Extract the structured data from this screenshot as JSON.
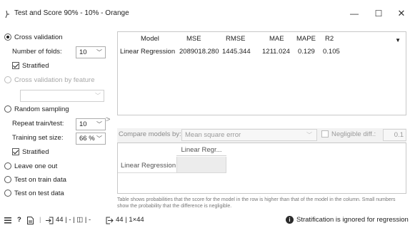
{
  "window": {
    "title": "Test and Score 90% - 10% - Orange",
    "min_glyph": "—",
    "max_glyph": "☐",
    "close_glyph": "✕"
  },
  "sampling": {
    "cross_validation": {
      "label": "Cross validation",
      "checked": true
    },
    "number_of_folds": {
      "label": "Number of folds:",
      "value": "10"
    },
    "stratified_cv": {
      "label": "Stratified",
      "checked": true
    },
    "cv_by_feature": {
      "label": "Cross validation by feature",
      "enabled": false
    },
    "feature_combo_value": "",
    "random_sampling": {
      "label": "Random sampling",
      "checked": false
    },
    "repeat_train_test": {
      "label": "Repeat train/test:",
      "value": "10"
    },
    "training_set_size": {
      "label": "Training set size:",
      "value": "66 %"
    },
    "stratified_rs": {
      "label": "Stratified",
      "checked": true
    },
    "leave_one_out": {
      "label": "Leave one out",
      "checked": false
    },
    "test_on_train": {
      "label": "Test on train data",
      "checked": false
    },
    "test_on_test": {
      "label": "Test on test data",
      "checked": false
    }
  },
  "splitter_glyph": ">",
  "results": {
    "columns": [
      "Model",
      "MSE",
      "RMSE",
      "MAE",
      "MAPE",
      "R2"
    ],
    "rows": [
      [
        "Linear Regression",
        "2089018.280",
        "1445.344",
        "1211.024",
        "0.129",
        "0.105"
      ]
    ],
    "sort_glyph": "▼"
  },
  "compare": {
    "label": "Compare models by:",
    "value": "Mean square error",
    "negligible_label": "Negligible diff.:",
    "negligible_value": "0.1"
  },
  "comparison_table": {
    "column_header": "Linear Regr...",
    "row_header": "Linear Regression"
  },
  "footnote": "Table shows probabilities that the score for the model in the row is higher than that of the model in the column. Small numbers show the probability that the difference is negligible.",
  "status": {
    "input_summary": "44 | - | ◫ | -",
    "output_summary": "44 | 1×44",
    "info_message": "Stratification is ignored for regression"
  },
  "icons": {
    "menu": "hamburger-icon",
    "help": "help-icon",
    "report": "report-icon",
    "input": "input-icon",
    "output": "output-icon",
    "info": "info-icon"
  }
}
